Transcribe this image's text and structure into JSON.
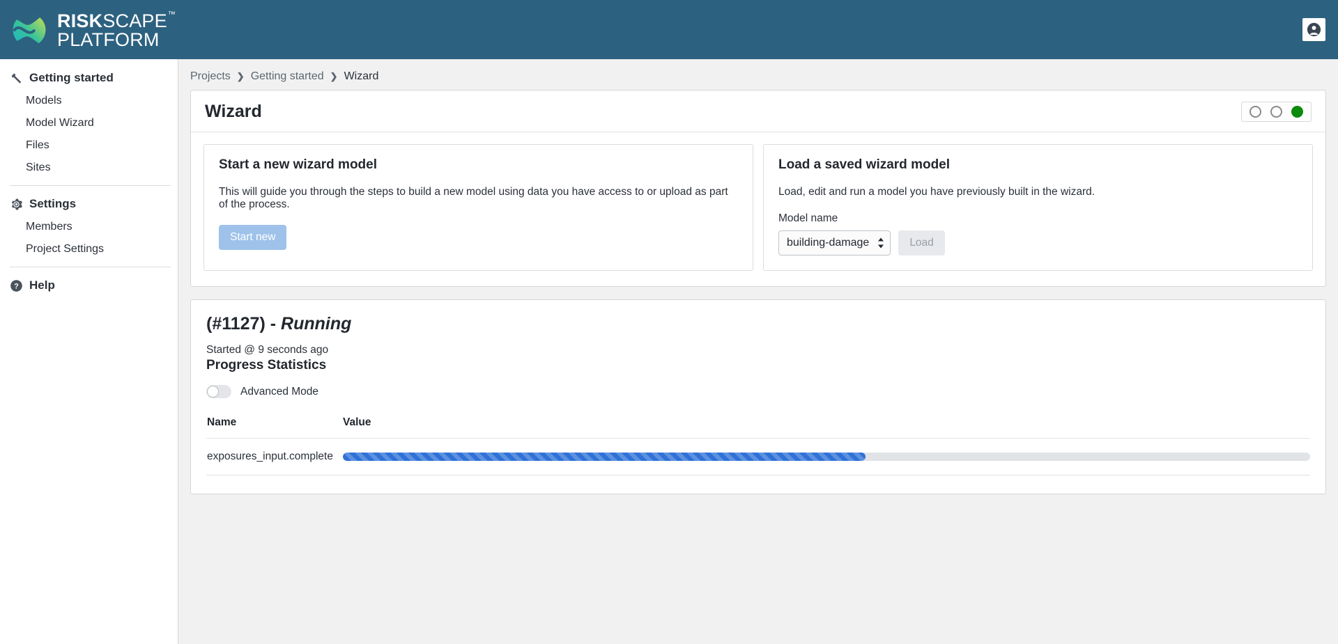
{
  "brand": {
    "name_bold": "RISK",
    "name_rest": "SCAPE",
    "trademark": "™",
    "line2": "PLATFORM",
    "logo_icon": "riskscape-globe-logo"
  },
  "topbar": {
    "user_icon": "user-account-icon"
  },
  "sidebar": {
    "groups": [
      {
        "label": "Getting started",
        "icon": "hammer-icon",
        "items": [
          {
            "label": "Models"
          },
          {
            "label": "Model Wizard"
          },
          {
            "label": "Files"
          },
          {
            "label": "Sites"
          }
        ]
      },
      {
        "label": "Settings",
        "icon": "gear-icon",
        "items": [
          {
            "label": "Members"
          },
          {
            "label": "Project Settings"
          }
        ]
      },
      {
        "label": "Help",
        "icon": "question-circle-icon",
        "items": []
      }
    ]
  },
  "breadcrumb": {
    "items": [
      {
        "label": "Projects",
        "current": false
      },
      {
        "label": "Getting started",
        "current": false
      },
      {
        "label": "Wizard",
        "current": true
      }
    ],
    "separator": "❯"
  },
  "wizard_card": {
    "title": "Wizard",
    "status_dots": [
      {
        "state": "empty",
        "color": "#8a8a8a"
      },
      {
        "state": "empty",
        "color": "#8a8a8a"
      },
      {
        "state": "filled",
        "color": "#0b8a0b"
      }
    ],
    "left_panel": {
      "title": "Start a new wizard model",
      "description": "This will guide you through the steps to build a new model using data you have access to or upload as part of the process.",
      "button_label": "Start new",
      "button_color": "#9ec2ea"
    },
    "right_panel": {
      "title": "Load a saved wizard model",
      "description": "Load, edit and run a model you have previously built in the wizard.",
      "field_label": "Model name",
      "select_value": "building-damage",
      "select_options": [
        "building-damage"
      ],
      "button_label": "Load"
    }
  },
  "run_card": {
    "title_id": "(#1127) - ",
    "title_state": "Running",
    "started": "Started @ 9 seconds ago",
    "subtitle": "Progress Statistics",
    "advanced_mode_label": "Advanced Mode",
    "advanced_mode_on": false,
    "table": {
      "headers": [
        "Name",
        "Value"
      ],
      "rows": [
        {
          "name": "exposures_input.complete",
          "progress_percent": 54,
          "bar_color": "#2f72d7"
        }
      ]
    }
  }
}
